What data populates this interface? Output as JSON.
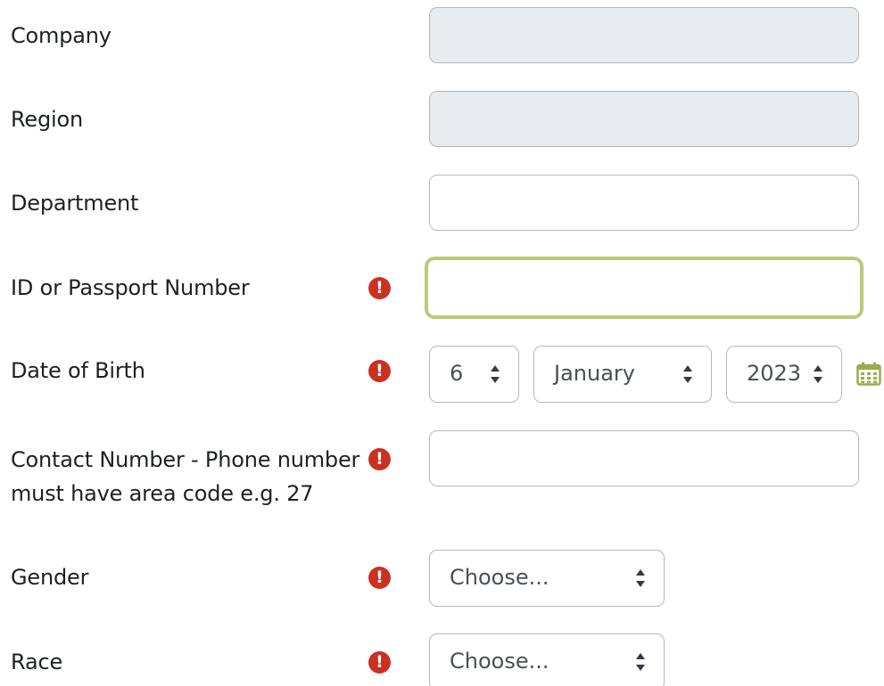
{
  "form": {
    "company": {
      "label": "Company",
      "value": ""
    },
    "region": {
      "label": "Region",
      "value": ""
    },
    "department": {
      "label": "Department",
      "value": ""
    },
    "id_passport": {
      "label": "ID or Passport Number",
      "value": ""
    },
    "dob": {
      "label": "Date of Birth",
      "day": "6",
      "month": "January",
      "year": "2023",
      "calendar_icon": "calendar-icon"
    },
    "contact": {
      "label_line1": "Contact Number - Phone number",
      "label_line2": "must have area code e.g. 27",
      "value": ""
    },
    "gender": {
      "label": "Gender",
      "selected": "Choose..."
    },
    "race": {
      "label": "Race",
      "selected": "Choose..."
    },
    "required_icon": {
      "name": "exclamation-circle-icon",
      "glyph": "!",
      "color": "#ca3120"
    },
    "focus_color": "#bccb7a",
    "disabled_bg": "#e9ecef"
  }
}
